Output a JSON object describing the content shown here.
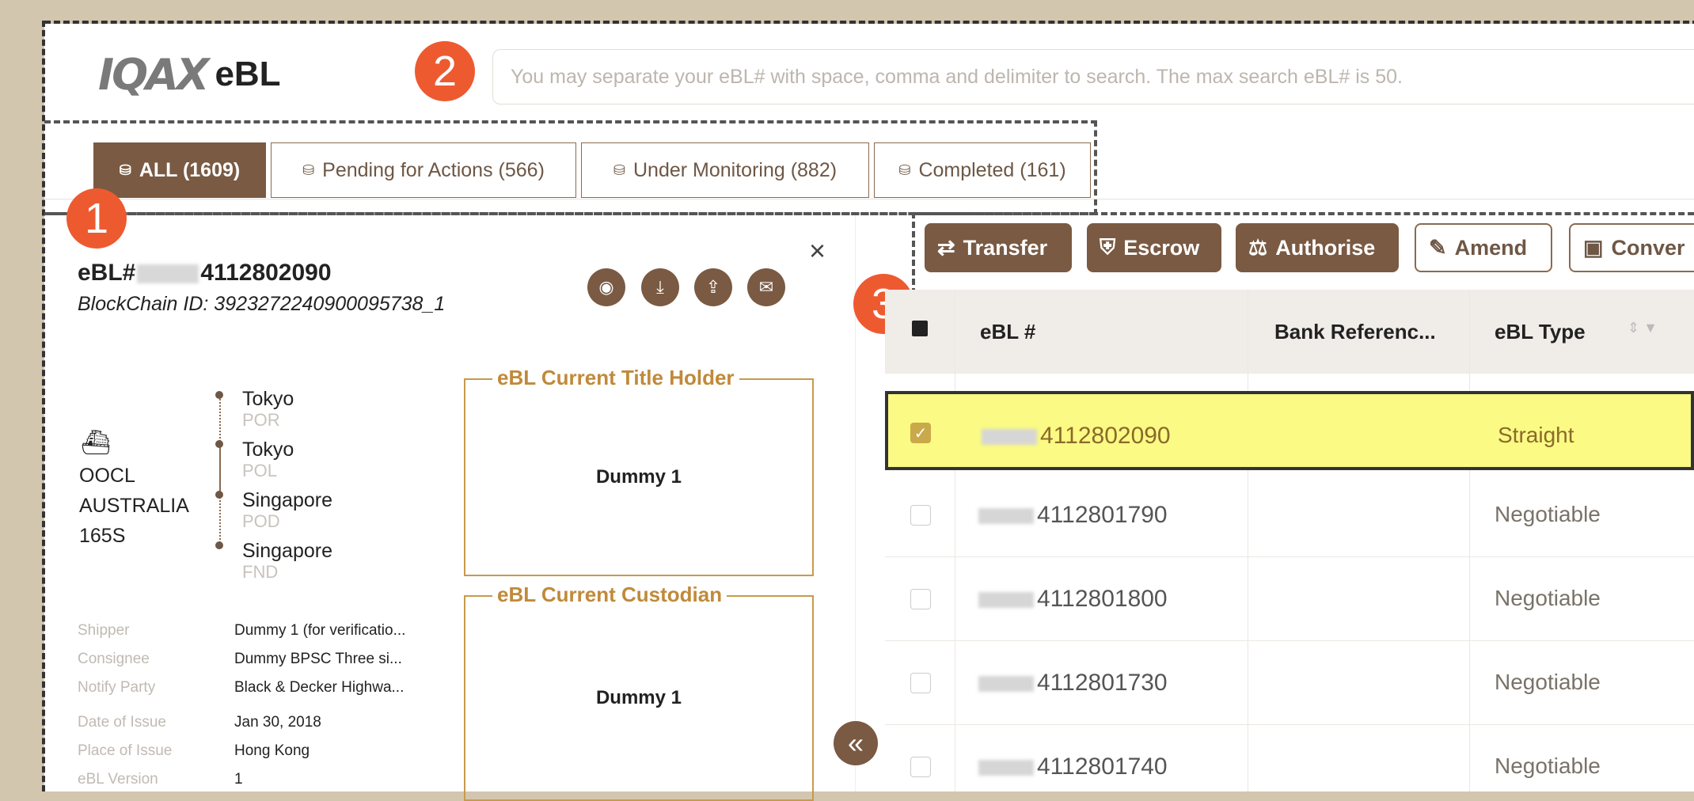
{
  "header": {
    "logo_mark": "IQAX",
    "logo_text": "eBL",
    "search_placeholder": "You may separate your eBL# with space, comma and delimiter to search. The max search eBL# is 50."
  },
  "callouts": [
    "1",
    "2",
    "3"
  ],
  "tabs": [
    {
      "label": "ALL (1609)",
      "active": true
    },
    {
      "label": "Pending for Actions (566)",
      "active": false
    },
    {
      "label": "Under Monitoring (882)",
      "active": false
    },
    {
      "label": "Completed (161)",
      "active": false
    }
  ],
  "detail": {
    "ebl_prefix": "eBL#",
    "ebl_number": "4112802090",
    "blockchain_id": "BlockChain ID: 3923272240900095738_1",
    "close": "×",
    "vessel": [
      "OOCL",
      "AUSTRALIA",
      "165S"
    ],
    "route": [
      {
        "city": "Tokyo",
        "code": "POR"
      },
      {
        "city": "Tokyo",
        "code": "POL"
      },
      {
        "city": "Singapore",
        "code": "POD"
      },
      {
        "city": "Singapore",
        "code": "FND"
      }
    ],
    "title_holder": {
      "legend": "eBL Current Title Holder",
      "name": "Dummy 1"
    },
    "custodian": {
      "legend": "eBL Current Custodian",
      "name": "Dummy 1"
    },
    "fields": [
      {
        "label": "Shipper",
        "value": "Dummy 1 (for verificatio..."
      },
      {
        "label": "Consignee",
        "value": "Dummy BPSC Three si..."
      },
      {
        "label": "Notify Party",
        "value": "Black & Decker Highwa..."
      },
      {
        "label": "Date of Issue",
        "value": "Jan 30, 2018"
      },
      {
        "label": "Place of Issue",
        "value": "Hong Kong"
      },
      {
        "label": "eBL Version",
        "value": "1"
      }
    ],
    "collapse": "«"
  },
  "toolbar": {
    "transfer": "Transfer",
    "escrow": "Escrow",
    "authorise": "Authorise",
    "amend": "Amend",
    "convert": "Conver"
  },
  "table": {
    "columns": [
      "eBL #",
      "Bank Referenc...",
      "eBL Type"
    ],
    "rows": [
      {
        "ebl": "4112802090",
        "bank_ref": "",
        "type": "Straight",
        "selected": true
      },
      {
        "ebl": "4112801790",
        "bank_ref": "",
        "type": "Negotiable",
        "selected": false
      },
      {
        "ebl": "4112801800",
        "bank_ref": "",
        "type": "Negotiable",
        "selected": false
      },
      {
        "ebl": "4112801730",
        "bank_ref": "",
        "type": "Negotiable",
        "selected": false
      },
      {
        "ebl": "4112801740",
        "bank_ref": "",
        "type": "Negotiable",
        "selected": false
      }
    ]
  },
  "colors": {
    "brand": "#7a5a43",
    "callout": "#ee5a30",
    "legend": "#c08a3a",
    "selected_row": "#fafa84"
  }
}
